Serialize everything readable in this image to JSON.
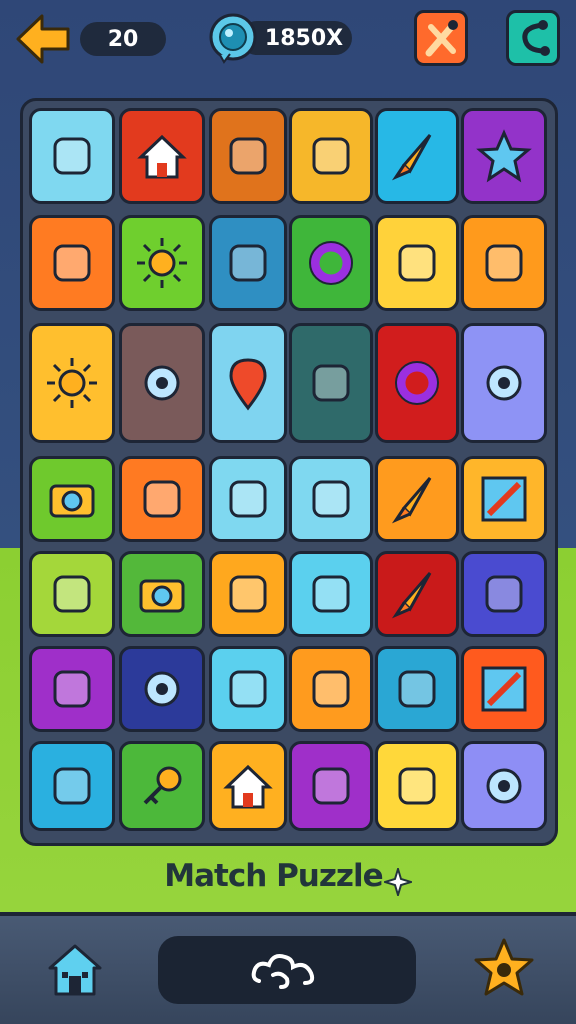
{
  "header": {
    "level": "20",
    "coins": "1850X",
    "back_icon": "arrow-left-icon",
    "coin_icon": "gem-coin-icon",
    "tools_icon": "tools-icon",
    "share_icon": "share-icon"
  },
  "board": {
    "rows": [
      [
        "#7fd8f0",
        "#e23a1e",
        "#e0731c",
        "#f6b72a",
        "#27b8e6",
        "#9333c9"
      ],
      [
        "#ff7b22",
        "#6fcf2e",
        "#2f8fc2",
        "#3fb63a",
        "#ffd23a",
        "#ff9a1c"
      ],
      [
        "#ffbf2e",
        "#7a5a5a",
        "#7fd4f0",
        "#2f6a6a",
        "#d11d1d",
        "#8e93f5"
      ],
      [
        "#6fc92d",
        "#ff7a22",
        "#7fd8f0",
        "#7fd8f0",
        "#ff9b1e",
        "#ffb62a"
      ],
      [
        "#a4d73a",
        "#53b83a",
        "#ffa81e",
        "#5bd0ee",
        "#c91a1a",
        "#4a4bd0"
      ],
      [
        "#9f2fc9",
        "#2c3a9a",
        "#5bd0ee",
        "#ff9b1e",
        "#2aa7d4",
        "#ff5a1e"
      ],
      [
        "#2ab0e0",
        "#4cb83a",
        "#ffb020",
        "#9f2fc9",
        "#ffd83a",
        "#8e8ef5"
      ]
    ],
    "icons": [
      [
        "battery-icon",
        "house-icon",
        "tools-cross-icon",
        "backpack-icon",
        "rocket-icon",
        "star-icon"
      ],
      [
        "toy-key-icon",
        "sun-icon",
        "paint-brush-icon",
        "ring-icon",
        "swirl-icon",
        "magnifier-icon"
      ],
      [
        "sun-icon",
        "gear-icon",
        "location-pin-icon",
        "slime-icon",
        "ring-icon",
        "gear-icon"
      ],
      [
        "camera-icon",
        "marker-icon",
        "briefcase-icon",
        "crystal-icon",
        "rocket-icon",
        "pencil-icon"
      ],
      [
        "carrot-icon",
        "camera-icon",
        "car-icon",
        "pencil-ball-icon",
        "rocket-icon",
        "button-icon"
      ],
      [
        "moon-icon",
        "gear-icon",
        "paint-icon",
        "cleaver-icon",
        "pen-icon",
        "pencil-icon"
      ],
      [
        "dumbbell-icon",
        "key-icon",
        "house-icon",
        "leaf-icon",
        "tools-box-icon",
        "gear-icon"
      ]
    ]
  },
  "title": "Match Puzzle",
  "footer": {
    "home_icon": "home-icon",
    "center_icon": "cloud-outline-icon",
    "star_icon": "star-icon"
  }
}
